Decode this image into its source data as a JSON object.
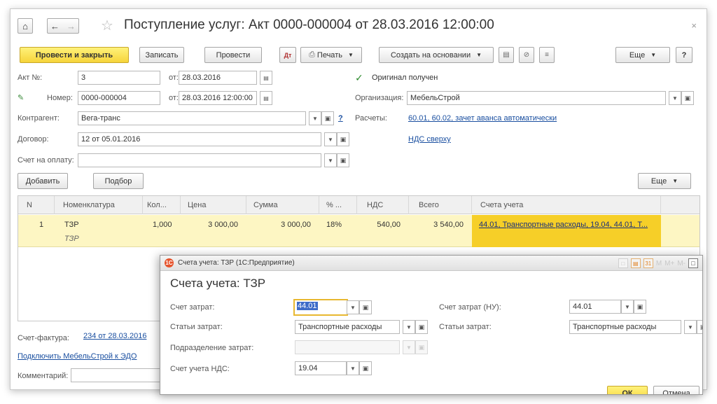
{
  "window": {
    "title": "Поступление услуг: Акт 0000-000004 от 28.03.2016 12:00:00",
    "close_glyph": "×"
  },
  "toolbar": {
    "post_close": "Провести и закрыть",
    "save": "Записать",
    "post": "Провести",
    "print": "Печать",
    "create_based": "Создать на основании",
    "more": "Еще",
    "help": "?"
  },
  "form": {
    "act_no_label": "Акт №:",
    "act_no_value": "3",
    "from_label": "от:",
    "act_date": "28.03.2016",
    "original_label": "Оригинал получен",
    "number_label": "Номер:",
    "number_value": "0000-000004",
    "number_date": "28.03.2016 12:00:00",
    "org_label": "Организация:",
    "org_value": "МебельСтрой",
    "counterparty_label": "Контрагент:",
    "counterparty_value": "Вега-транс",
    "help_link": "?",
    "settlements_label": "Расчеты:",
    "settlements_link": "60.01, 60.02, зачет аванса автоматически",
    "contract_label": "Договор:",
    "contract_value": "12 от 05.01.2016",
    "vat_link": "НДС сверху",
    "invoice_label": "Счет на оплату:",
    "invoice_value": ""
  },
  "table_toolbar": {
    "add": "Добавить",
    "pick": "Подбор",
    "more": "Еще"
  },
  "table": {
    "headers": [
      "N",
      "Номенклатура",
      "Кол...",
      "Цена",
      "Сумма",
      "% ...",
      "НДС",
      "Всего",
      "Счета учета"
    ],
    "rows": [
      {
        "n": "1",
        "item": "ТЗР",
        "item_sub": "ТЗР",
        "qty": "1,000",
        "price": "3 000,00",
        "sum": "3 000,00",
        "vat_rate": "18%",
        "vat": "540,00",
        "total": "3 540,00",
        "accounts": "44.01, Транспортные расходы, 19.04, 44.01, Т..."
      }
    ]
  },
  "footer": {
    "invoice_label": "Счет-фактура:",
    "invoice_link": "234 от 28.03.2016",
    "edo_link": "Подключить МебельСтрой к ЭДО",
    "comment_label": "Комментарий:"
  },
  "dialog": {
    "title": "Счета учета: ТЗР (1С:Предприятие)",
    "heading": "Счета учета: ТЗР",
    "cost_account_label": "Счет затрат:",
    "cost_account_value": "44.01",
    "cost_items_label": "Статьи затрат:",
    "cost_items_value": "Транспортные расходы",
    "division_label": "Подразделение затрат:",
    "division_value": "",
    "vat_account_label": "Счет учета НДС:",
    "vat_account_value": "19.04",
    "cost_account_nu_label": "Счет затрат (НУ):",
    "cost_account_nu_value": "44.01",
    "cost_items_nu_label": "Статьи затрат:",
    "cost_items_nu_value": "Транспортные расходы",
    "ok": "ОК",
    "cancel": "Отмена",
    "tool_m": "M",
    "tool_mplus": "M+",
    "tool_mminus": "M-"
  }
}
